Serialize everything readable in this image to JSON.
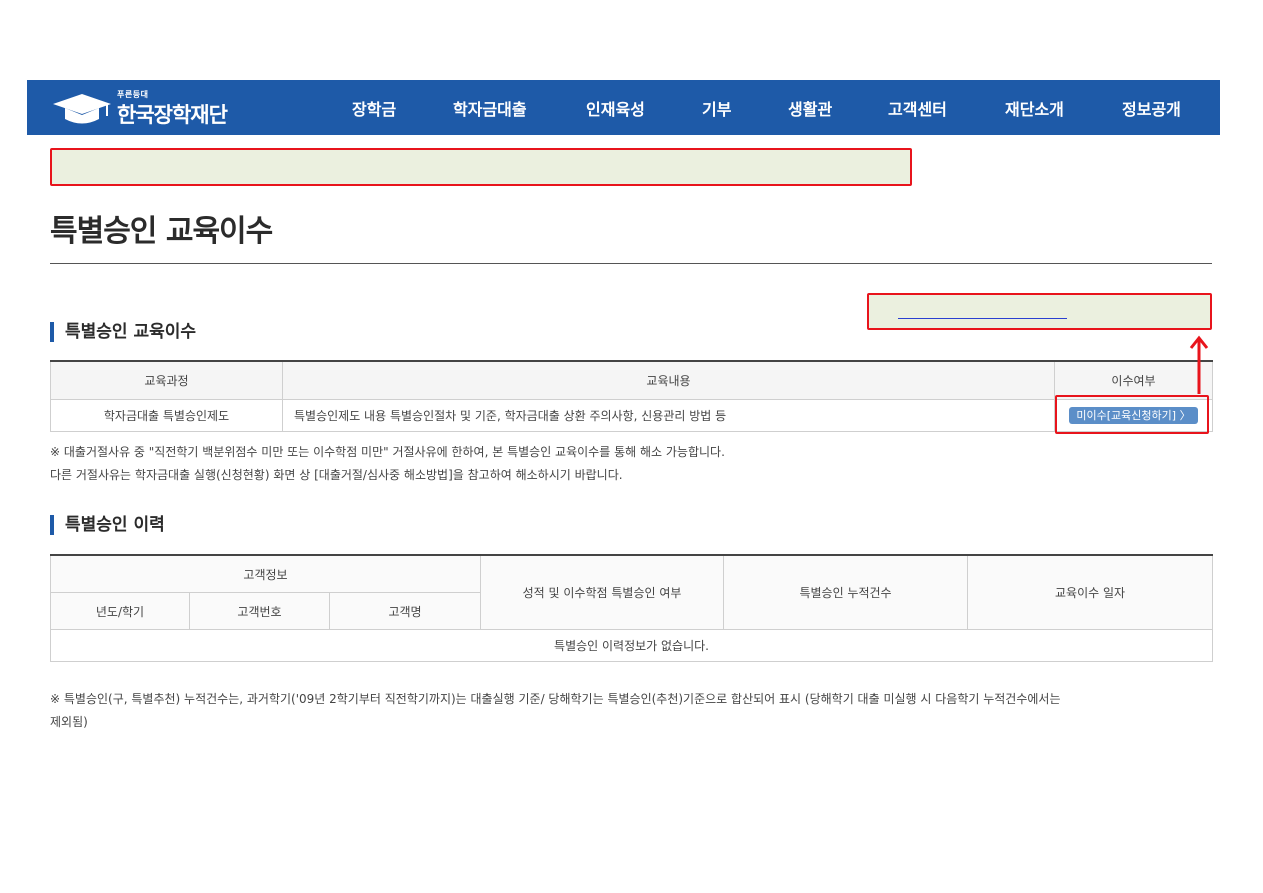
{
  "header": {
    "logo_small": "푸른등대",
    "logo_main": "한국장학재단",
    "nav": [
      "장학금",
      "학자금대출",
      "인재육성",
      "기부",
      "생활관",
      "고객센터",
      "재단소개",
      "정보공개"
    ]
  },
  "page_title": "특별승인 교육이수",
  "section1": {
    "title": "특별승인 교육이수",
    "columns": [
      "교육과정",
      "교육내용",
      "이수여부"
    ],
    "row": {
      "course": "학자금대출 특별승인제도",
      "content": "특별승인제도 내용 특별승인절차 및 기준, 학자금대출 상환 주의사항, 신용관리 방법 등",
      "status_button": "미이수[교육신청하기]  〉"
    },
    "notes": [
      "※ 대출거절사유 중 \"직전학기 백분위점수 미만 또는 이수학점 미만\" 거절사유에 한하여, 본 특별승인 교육이수를 통해 해소 가능합니다.",
      "다른 거절사유는 학자금대출 실행(신청현황) 화면 상 [대출거절/심사중 해소방법]을 참고하여 해소하시기 바랍니다."
    ]
  },
  "section2": {
    "title": "특별승인 이력",
    "group_header": "고객정보",
    "sub_columns": [
      "년도/학기",
      "고객번호",
      "고객명"
    ],
    "columns": [
      "성적 및 이수학점 특별승인 여부",
      "특별승인 누적건수",
      "교육이수 일자"
    ],
    "empty_message": "특별승인 이력정보가 없습니다.",
    "footnote": "※ 특별승인(구, 특별추천) 누적건수는, 과거학기('09년 2학기부터 직전학기까지)는 대출실행 기준/ 당해학기는 특별승인(추천)기준으로 합산되어 표시 (당해학기 대출 미실행 시 다음학기 누적건수에서는",
    "footnote_cont": "제외됨)"
  },
  "colors": {
    "header_bg": "#1e5aa8",
    "highlight_border": "#e8141c",
    "highlight_fill": "#ebf0df",
    "button_bg": "#5b8ec8"
  }
}
